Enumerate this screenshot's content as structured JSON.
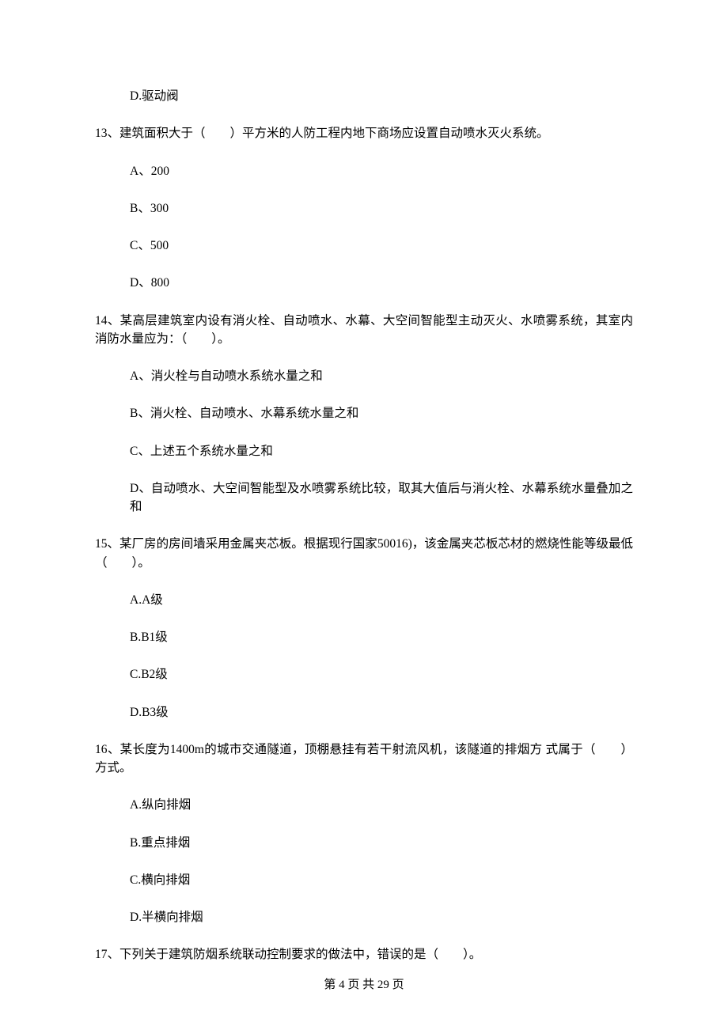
{
  "prev_q_option_d": "D.驱动阀",
  "q13": {
    "stem": "13、建筑面积大于（　　）平方米的人防工程内地下商场应设置自动喷水灭火系统。",
    "a": "A、200",
    "b": "B、300",
    "c": "C、500",
    "d": "D、800"
  },
  "q14": {
    "stem": "14、某高层建筑室内设有消火栓、自动喷水、水幕、大空间智能型主动灭火、水喷雾系统，其室内消防水量应为：（　　）。",
    "a": "A、消火栓与自动喷水系统水量之和",
    "b": "B、消火栓、自动喷水、水幕系统水量之和",
    "c": "C、上述五个系统水量之和",
    "d": "D、自动喷水、大空间智能型及水喷雾系统比较，取其大值后与消火栓、水幕系统水量叠加之和"
  },
  "q15": {
    "stem": "15、某厂房的房间墙采用金属夹芯板。根据现行国家50016)，该金属夹芯板芯材的燃烧性能等级最低（　　）。",
    "a": "A.A级",
    "b": "B.B1级",
    "c": "C.B2级",
    "d": "D.B3级"
  },
  "q16": {
    "stem": "16、某长度为1400m的城市交通隧道，顶棚悬挂有若干射流风机，该隧道的排烟方 式属于（　　）方式。",
    "a": "A.纵向排烟",
    "b": "B.重点排烟",
    "c": "C.横向排烟",
    "d": "D.半横向排烟"
  },
  "q17": {
    "stem": "17、下列关于建筑防烟系统联动控制要求的做法中，错误的是（　　）。"
  },
  "footer": "第 4 页 共 29 页"
}
